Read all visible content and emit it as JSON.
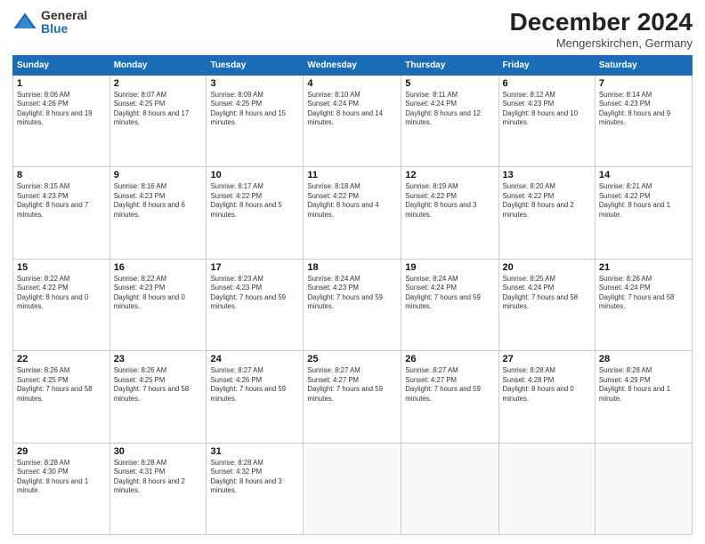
{
  "header": {
    "logo_general": "General",
    "logo_blue": "Blue",
    "title": "December 2024",
    "location": "Mengerskirchen, Germany"
  },
  "weekdays": [
    "Sunday",
    "Monday",
    "Tuesday",
    "Wednesday",
    "Thursday",
    "Friday",
    "Saturday"
  ],
  "weeks": [
    [
      {
        "day": "1",
        "sunrise": "8:06 AM",
        "sunset": "4:26 PM",
        "daylight": "8 hours and 19 minutes."
      },
      {
        "day": "2",
        "sunrise": "8:07 AM",
        "sunset": "4:25 PM",
        "daylight": "8 hours and 17 minutes."
      },
      {
        "day": "3",
        "sunrise": "8:09 AM",
        "sunset": "4:25 PM",
        "daylight": "8 hours and 15 minutes."
      },
      {
        "day": "4",
        "sunrise": "8:10 AM",
        "sunset": "4:24 PM",
        "daylight": "8 hours and 14 minutes."
      },
      {
        "day": "5",
        "sunrise": "8:11 AM",
        "sunset": "4:24 PM",
        "daylight": "8 hours and 12 minutes."
      },
      {
        "day": "6",
        "sunrise": "8:12 AM",
        "sunset": "4:23 PM",
        "daylight": "8 hours and 10 minutes."
      },
      {
        "day": "7",
        "sunrise": "8:14 AM",
        "sunset": "4:23 PM",
        "daylight": "8 hours and 9 minutes."
      }
    ],
    [
      {
        "day": "8",
        "sunrise": "8:15 AM",
        "sunset": "4:23 PM",
        "daylight": "8 hours and 7 minutes."
      },
      {
        "day": "9",
        "sunrise": "8:16 AM",
        "sunset": "4:23 PM",
        "daylight": "8 hours and 6 minutes."
      },
      {
        "day": "10",
        "sunrise": "8:17 AM",
        "sunset": "4:22 PM",
        "daylight": "8 hours and 5 minutes."
      },
      {
        "day": "11",
        "sunrise": "8:18 AM",
        "sunset": "4:22 PM",
        "daylight": "8 hours and 4 minutes."
      },
      {
        "day": "12",
        "sunrise": "8:19 AM",
        "sunset": "4:22 PM",
        "daylight": "8 hours and 3 minutes."
      },
      {
        "day": "13",
        "sunrise": "8:20 AM",
        "sunset": "4:22 PM",
        "daylight": "8 hours and 2 minutes."
      },
      {
        "day": "14",
        "sunrise": "8:21 AM",
        "sunset": "4:22 PM",
        "daylight": "8 hours and 1 minute."
      }
    ],
    [
      {
        "day": "15",
        "sunrise": "8:22 AM",
        "sunset": "4:22 PM",
        "daylight": "8 hours and 0 minutes."
      },
      {
        "day": "16",
        "sunrise": "8:22 AM",
        "sunset": "4:23 PM",
        "daylight": "8 hours and 0 minutes."
      },
      {
        "day": "17",
        "sunrise": "8:23 AM",
        "sunset": "4:23 PM",
        "daylight": "7 hours and 59 minutes."
      },
      {
        "day": "18",
        "sunrise": "8:24 AM",
        "sunset": "4:23 PM",
        "daylight": "7 hours and 59 minutes."
      },
      {
        "day": "19",
        "sunrise": "8:24 AM",
        "sunset": "4:24 PM",
        "daylight": "7 hours and 59 minutes."
      },
      {
        "day": "20",
        "sunrise": "8:25 AM",
        "sunset": "4:24 PM",
        "daylight": "7 hours and 58 minutes."
      },
      {
        "day": "21",
        "sunrise": "8:26 AM",
        "sunset": "4:24 PM",
        "daylight": "7 hours and 58 minutes."
      }
    ],
    [
      {
        "day": "22",
        "sunrise": "8:26 AM",
        "sunset": "4:25 PM",
        "daylight": "7 hours and 58 minutes."
      },
      {
        "day": "23",
        "sunrise": "8:26 AM",
        "sunset": "4:25 PM",
        "daylight": "7 hours and 58 minutes."
      },
      {
        "day": "24",
        "sunrise": "8:27 AM",
        "sunset": "4:26 PM",
        "daylight": "7 hours and 59 minutes."
      },
      {
        "day": "25",
        "sunrise": "8:27 AM",
        "sunset": "4:27 PM",
        "daylight": "7 hours and 59 minutes."
      },
      {
        "day": "26",
        "sunrise": "8:27 AM",
        "sunset": "4:27 PM",
        "daylight": "7 hours and 59 minutes."
      },
      {
        "day": "27",
        "sunrise": "8:28 AM",
        "sunset": "4:28 PM",
        "daylight": "8 hours and 0 minutes."
      },
      {
        "day": "28",
        "sunrise": "8:28 AM",
        "sunset": "4:29 PM",
        "daylight": "8 hours and 1 minute."
      }
    ],
    [
      {
        "day": "29",
        "sunrise": "8:28 AM",
        "sunset": "4:30 PM",
        "daylight": "8 hours and 1 minute."
      },
      {
        "day": "30",
        "sunrise": "8:28 AM",
        "sunset": "4:31 PM",
        "daylight": "8 hours and 2 minutes."
      },
      {
        "day": "31",
        "sunrise": "8:28 AM",
        "sunset": "4:32 PM",
        "daylight": "8 hours and 3 minutes."
      },
      null,
      null,
      null,
      null
    ]
  ]
}
